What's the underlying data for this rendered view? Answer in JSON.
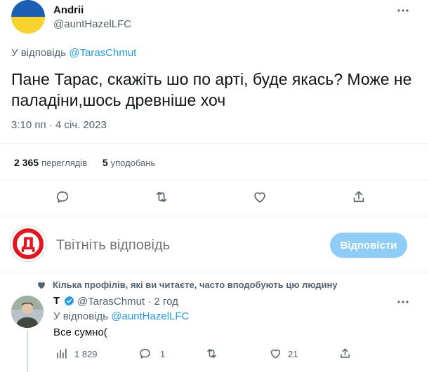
{
  "main_tweet": {
    "author_name": "Andrii",
    "author_handle": "@auntHazelLFC",
    "reply_to_prefix": "У відповідь",
    "reply_to_handle": "@TarasChmut",
    "text": "Пане Тарас, скажіть шо по арті, буде якась? Може не паладіни,шось древніше хоч",
    "time": "3:10 пп · 4 січ. 2023",
    "views_count": "2 365",
    "views_label": "переглядів",
    "likes_count": "5",
    "likes_label": "уподобань"
  },
  "compose": {
    "avatar_letter": "Д",
    "placeholder": "Твітніть відповідь",
    "reply_button": "Відповісти"
  },
  "reply_tweet": {
    "social_context": "Кілька профілів, які ви читаєте, часто вподобують цю людину",
    "author_name": "T",
    "author_handle": "@TarasChmut",
    "time": "· 2 год",
    "reply_to_prefix": "У відповідь",
    "reply_to_handle": "@auntHazelLFC",
    "text": "Все сумно(",
    "views_count": "1 829",
    "replies_count": "1",
    "likes_count": "21"
  },
  "colors": {
    "accent": "#1d9bf0",
    "flag_blue": "#1a5fb4",
    "flag_yellow": "#f6d32d",
    "avatar_red": "#e3161d",
    "button_disabled": "#8ecdf8"
  },
  "icons": [
    "more-icon",
    "reply-icon",
    "retweet-icon",
    "like-icon",
    "share-icon",
    "views-icon",
    "verified-icon",
    "heart-icon"
  ]
}
